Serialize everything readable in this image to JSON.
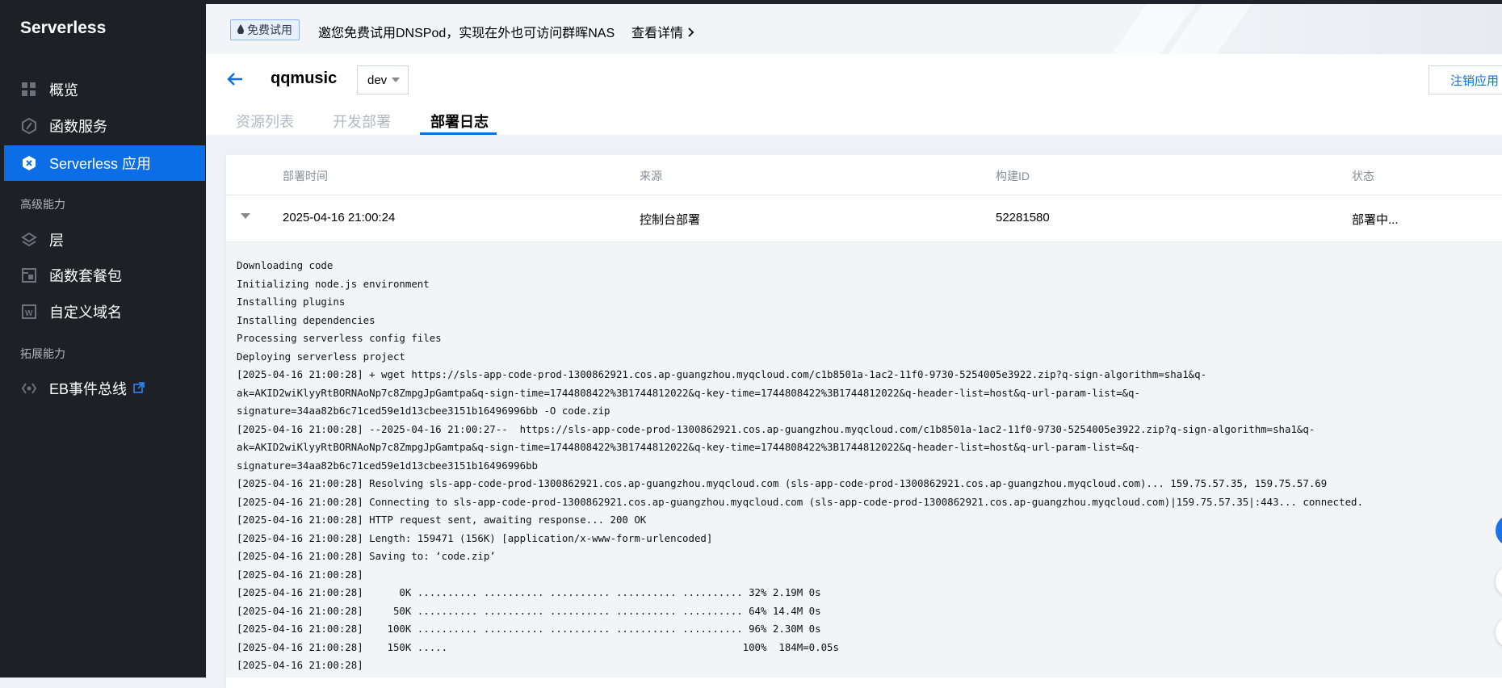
{
  "sidebar": {
    "brand": "Serverless",
    "items": [
      {
        "label": "概览"
      },
      {
        "label": "函数服务"
      },
      {
        "label": "Serverless 应用"
      },
      {
        "label": "层"
      },
      {
        "label": "函数套餐包"
      },
      {
        "label": "自定义域名"
      },
      {
        "label": "EB事件总线"
      }
    ],
    "groups": [
      "高级能力",
      "拓展能力"
    ]
  },
  "banner": {
    "badge": "免费试用",
    "text": "邀您免费试用DNSPod，实现在外也可访问群晖NAS",
    "link": "查看详情"
  },
  "header": {
    "app_name": "qqmusic",
    "env": "dev",
    "cancel_label": "注销应用",
    "tabs": [
      {
        "label": "资源列表"
      },
      {
        "label": "开发部署"
      },
      {
        "label": "部署日志"
      }
    ]
  },
  "table": {
    "columns": [
      "部署时间",
      "来源",
      "构建ID",
      "状态"
    ],
    "row": {
      "time": "2025-04-16 21:00:24",
      "source": "控制台部署",
      "build_id": "52281580",
      "status": "部署中..."
    }
  },
  "log": [
    "Downloading code",
    "Initializing node.js environment",
    "Installing plugins",
    "Installing dependencies",
    "Processing serverless config files",
    "Deploying serverless project",
    "[2025-04-16 21:00:28] + wget https://sls-app-code-prod-1300862921.cos.ap-guangzhou.myqcloud.com/c1b8501a-1ac2-11f0-9730-5254005e3922.zip?q-sign-algorithm=sha1&q-",
    "ak=AKID2wiKlyyRtBORNAoNp7c8ZmpgJpGamtpa&q-sign-time=1744808422%3B1744812022&q-key-time=1744808422%3B1744812022&q-header-list=host&q-url-param-list=&q-",
    "signature=34aa82b6c71ced59e1d13cbee3151b16496996bb -O code.zip",
    "[2025-04-16 21:00:28] --2025-04-16 21:00:27--  https://sls-app-code-prod-1300862921.cos.ap-guangzhou.myqcloud.com/c1b8501a-1ac2-11f0-9730-5254005e3922.zip?q-sign-algorithm=sha1&q-",
    "ak=AKID2wiKlyyRtBORNAoNp7c8ZmpgJpGamtpa&q-sign-time=1744808422%3B1744812022&q-key-time=1744808422%3B1744812022&q-header-list=host&q-url-param-list=&q-",
    "signature=34aa82b6c71ced59e1d13cbee3151b16496996bb",
    "[2025-04-16 21:00:28] Resolving sls-app-code-prod-1300862921.cos.ap-guangzhou.myqcloud.com (sls-app-code-prod-1300862921.cos.ap-guangzhou.myqcloud.com)... 159.75.57.35, 159.75.57.69",
    "[2025-04-16 21:00:28] Connecting to sls-app-code-prod-1300862921.cos.ap-guangzhou.myqcloud.com (sls-app-code-prod-1300862921.cos.ap-guangzhou.myqcloud.com)|159.75.57.35|:443... connected.",
    "[2025-04-16 21:00:28] HTTP request sent, awaiting response... 200 OK",
    "[2025-04-16 21:00:28] Length: 159471 (156K) [application/x-www-form-urlencoded]",
    "[2025-04-16 21:00:28] Saving to: ‘code.zip’",
    "[2025-04-16 21:00:28]",
    "[2025-04-16 21:00:28]      0K .......... .......... .......... .......... .......... 32% 2.19M 0s",
    "[2025-04-16 21:00:28]     50K .......... .......... .......... .......... .......... 64% 14.4M 0s",
    "[2025-04-16 21:00:28]    100K .......... .......... .......... .......... .......... 96% 2.30M 0s",
    "[2025-04-16 21:00:28]    150K .....                                                 100%  184M=0.05s",
    "[2025-04-16 21:00:28]"
  ],
  "colors": {
    "accent": "#0b6ee6",
    "sidebar_bg": "#1e2026"
  }
}
